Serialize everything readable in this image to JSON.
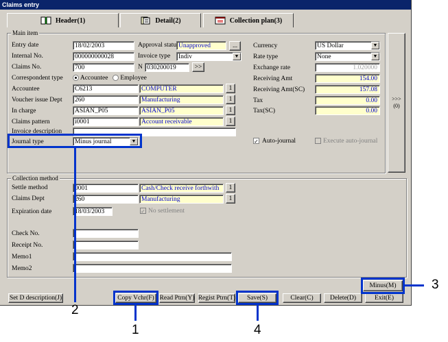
{
  "window": {
    "title": "Claims entry"
  },
  "tabs": [
    {
      "label": "Header(1)",
      "icon": "book-icon"
    },
    {
      "label": "Detail(2)",
      "icon": "pages-icon"
    },
    {
      "label": "Collection plan(3)",
      "icon": "document-window-icon"
    }
  ],
  "main_item": {
    "title": "Main item",
    "entry_date": {
      "label": "Entry date",
      "value": "18/02/2003"
    },
    "internal_no": {
      "label": "Internal No.",
      "value": "000000000028"
    },
    "claims_no": {
      "label": "Claims No.",
      "value": "700"
    },
    "correspondent_type": {
      "label": "Correspondent type",
      "options": [
        "Accountee",
        "Employee"
      ],
      "selected": "Accountee"
    },
    "accountee": {
      "label": "Accountee",
      "code": "C6213",
      "name": "COMPUTER"
    },
    "voucher_issue_dept": {
      "label": "Voucher issue Dept",
      "code": "260",
      "name": "Manufacturing"
    },
    "in_charge": {
      "label": "In charge",
      "code": "ASIAN_P05",
      "name": "ASIAN_P05"
    },
    "claims_pattern": {
      "label": "Claims pattern",
      "code": "i0001",
      "name": "Account receivable"
    },
    "invoice_description": {
      "label": "Invoice description",
      "value": ""
    },
    "journal_type": {
      "label": "Journal type",
      "value": "Minus journal"
    },
    "approval_status": {
      "label": "Approval status",
      "value": "Unapproved",
      "button": "..."
    },
    "invoice_type": {
      "label": "Invoice type",
      "value": "Indiv"
    },
    "n_field": {
      "label": "N",
      "value": "030200019",
      "button": ">>"
    },
    "currency": {
      "label": "Currency",
      "value": "US Dollar"
    },
    "rate_type": {
      "label": "Rate type",
      "value": "None"
    },
    "exchange_rate": {
      "label": "Exchange rate",
      "value": "1.020000"
    },
    "receiving_amt": {
      "label": "Receiving Amt",
      "value": "154.00"
    },
    "receiving_amt_sc": {
      "label": "Receiving Amt(SC)",
      "value": "157.08"
    },
    "tax": {
      "label": "Tax",
      "value": "0.00"
    },
    "tax_sc": {
      "label": "Tax(SC)",
      "value": "0.00"
    },
    "auto_journal": {
      "label": "Auto-journal",
      "checked": true
    },
    "execute_auto_journal": {
      "label": "Execute auto-journal",
      "checked": false
    },
    "lookup_button": "1",
    "side_button": ">>>(0)"
  },
  "collection_method": {
    "title": "Collection method",
    "settle_method": {
      "label": "Settle method",
      "code": "0001",
      "name": "Cash/Check receive forthwith"
    },
    "claims_dept": {
      "label": "Claims Dept",
      "code": "260",
      "name": "Manufacturing"
    },
    "expiration_date": {
      "label": "Expiration date",
      "value": "18/03/2003"
    },
    "no_settlement": {
      "label": "No settlement",
      "checked": true
    },
    "check_no": {
      "label": "Check No.",
      "value": ""
    },
    "receipt_no": {
      "label": "Receipt No.",
      "value": ""
    },
    "memo1": {
      "label": "Memo1",
      "value": ""
    },
    "memo2": {
      "label": "Memo2",
      "value": ""
    }
  },
  "buttons": {
    "minus": "Minus(M)",
    "set_d_description": "Set D description(J)",
    "copy_vchr": "Copy Vchr(F)",
    "read_ptrn": "Read Ptrn(Y)",
    "regist_ptrn": "Regist Ptrn(T)",
    "save": "Save(S)",
    "clear": "Clear(C)",
    "delete": "Delete(D)",
    "exit": "Exit(E)"
  },
  "callouts": [
    "1",
    "2",
    "3",
    "4"
  ],
  "colors": {
    "highlight": "#0033cc",
    "readonly_bg": "#ffffcc",
    "title_bar": "#0a246a"
  }
}
